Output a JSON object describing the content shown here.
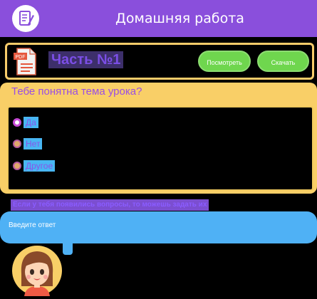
{
  "header": {
    "title": "Домашняя работа",
    "logo_icon": "notepad-pencil-icon"
  },
  "file": {
    "name": "Часть №1",
    "icon": "pdf-file-icon",
    "icon_label": "PDF",
    "view_label": "Посмотреть",
    "download_label": "Скачать"
  },
  "question": {
    "title": "Тебе понятна тема урока?",
    "options": [
      {
        "label": "Да",
        "selected": true
      },
      {
        "label": "Нет",
        "selected": false
      },
      {
        "label": "Другое",
        "selected": false
      }
    ]
  },
  "prompt": "Если у тебя появились вопросы, то можешь задать их",
  "answer": {
    "placeholder": "Введите ответ",
    "value": ""
  },
  "avatar": {
    "icon": "girl-avatar-icon"
  },
  "colors": {
    "header": "#8a4fdc",
    "accent_yellow": "#f9cf67",
    "accent_green": "#6fd64e",
    "accent_blue": "#4fb1f5",
    "accent_purple": "#9a4ee4"
  }
}
